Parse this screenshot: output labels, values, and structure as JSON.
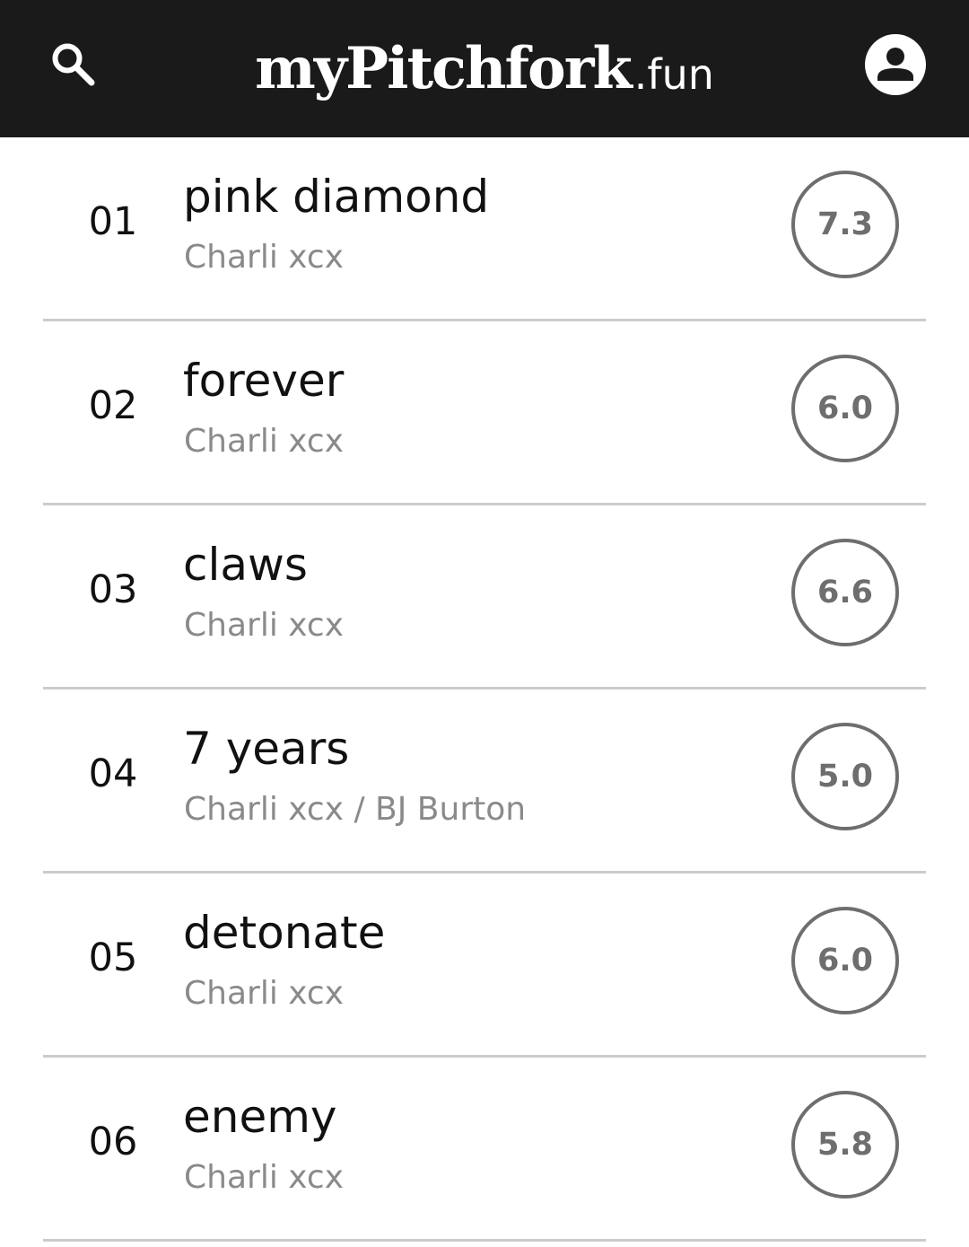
{
  "header": {
    "logo_main": "myPitchfork",
    "logo_tld": ".fun",
    "background_color": "#1a1a1a",
    "search_icon": "search-icon",
    "account_icon": "account-circle-icon"
  },
  "tracks": [
    {
      "number": "01",
      "title": "pink diamond",
      "artist": "Charli xcx",
      "score": "7.3"
    },
    {
      "number": "02",
      "title": "forever",
      "artist": "Charli xcx",
      "score": "6.0"
    },
    {
      "number": "03",
      "title": "claws",
      "artist": "Charli xcx",
      "score": "6.6"
    },
    {
      "number": "04",
      "title": "7 years",
      "artist": "Charli xcx / BJ Burton",
      "score": "5.0"
    },
    {
      "number": "05",
      "title": "detonate",
      "artist": "Charli xcx",
      "score": "6.0"
    },
    {
      "number": "06",
      "title": "enemy",
      "artist": "Charli xcx",
      "score": "5.8"
    }
  ]
}
